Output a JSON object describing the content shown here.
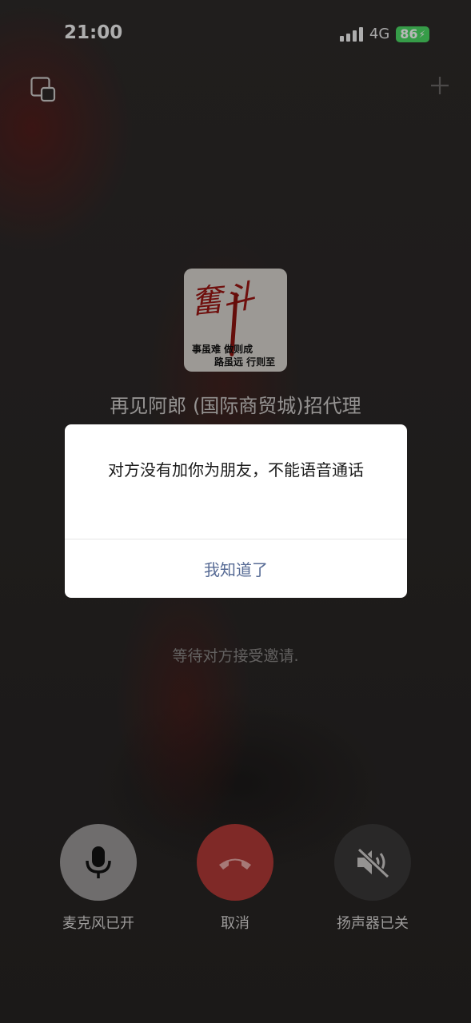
{
  "status_bar": {
    "time": "21:00",
    "network": "4G",
    "battery": "86",
    "colors": {
      "battery": "#4cd964"
    }
  },
  "top_bar": {
    "pip_icon": "floating-window-icon",
    "add_icon": "plus-icon"
  },
  "caller": {
    "avatar_text_title": "奮斗",
    "avatar_text_line1": "事虽难  做则成",
    "avatar_text_line2": "路虽远  行则至",
    "name": "再见阿郎 (国际商贸城)招代理",
    "status": "等待对方接受邀请."
  },
  "dialog": {
    "message": "对方没有加你为朋友，不能语音通话",
    "confirm_label": "我知道了",
    "colors": {
      "confirm": "#576b95"
    }
  },
  "controls": {
    "mic": {
      "label": "麦克风已开",
      "icon": "microphone-icon"
    },
    "cancel": {
      "label": "取消",
      "icon": "hangup-icon",
      "color": "#b03a36"
    },
    "speaker": {
      "label": "扬声器已关",
      "icon": "speaker-muted-icon"
    }
  }
}
